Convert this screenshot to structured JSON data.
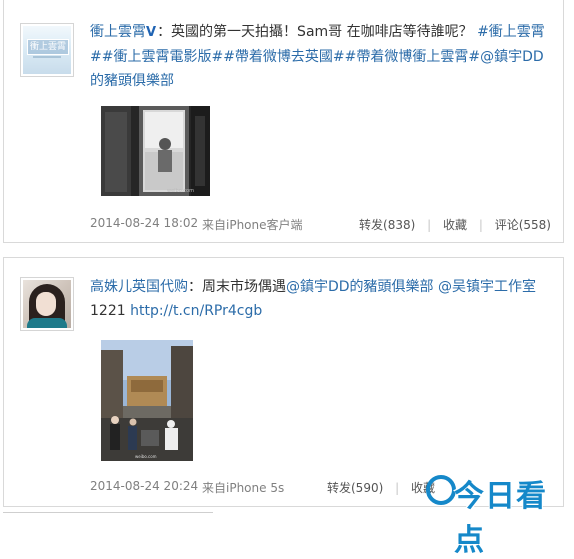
{
  "posts": [
    {
      "avatar_icon": "weibo-logo-avatar",
      "avatar_text": "衝上雲霄",
      "username": "衝上雲霄",
      "verified_icon": "verified-v-icon",
      "body_plain_1": "：英國的第一天拍攝！Sam哥 在咖啡店等待誰呢？",
      "topics": "#衝上雲霄##衝上雲霄電影版##帶着微博去英國##帶着微博衝上雲霄#",
      "mention": "@鎮宇DD的豬頭俱樂部",
      "image_desc_icon": "cafe-photo",
      "time": "2014-08-24 18:02",
      "source": "来自iPhone客户端",
      "repost": "转发(838)",
      "favorite": "收藏",
      "comment": "评论(558)"
    },
    {
      "avatar_icon": "user-portrait-avatar",
      "username": "高姝儿英国代购",
      "body_plain_1": "：周末市场偶遇",
      "mention_1": "@鎮宇DD的豬頭俱樂部",
      "mention_2": "@吴镇宇工作室",
      "body_plain_2": "1221",
      "url": "http://t.cn/RPr4cgb",
      "image_desc_icon": "street-market-photo",
      "time": "2014-08-24 20:24",
      "source": "来自iPhone 5s",
      "repost": "转发(590)",
      "favorite": "收藏"
    }
  ],
  "watermark": {
    "text": "今日看点",
    "color": "#1588c9"
  },
  "colors": {
    "link": "#2c6ca9",
    "meta": "#808080",
    "border": "#d9d9d9"
  }
}
